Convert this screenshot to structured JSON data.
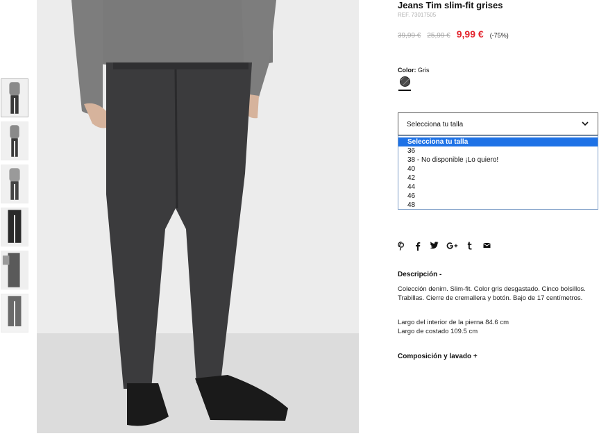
{
  "product": {
    "title": "Jeans Tim slim-fit grises",
    "ref": "REF. 73017505",
    "price_original": "39,99 €",
    "price_previous": "25,99 €",
    "price_current": "9,99 €",
    "discount": "(-75%)",
    "color_label": "Color:",
    "color_value": "Gris"
  },
  "size_select": {
    "label": "Selecciona tu talla",
    "options": [
      "Selecciona tu talla",
      "36",
      "38 - No disponible ¡Lo quiero!",
      "40",
      "42",
      "44",
      "46",
      "48"
    ],
    "selected_index": 0
  },
  "share": [
    "pinterest-icon",
    "facebook-icon",
    "twitter-icon",
    "google-plus-icon",
    "tumblr-icon",
    "mail-icon"
  ],
  "description": {
    "heading": "Descripción  -",
    "text": "Colección denim. Slim-fit. Color gris desgastado. Cinco bolsillos. Trabillas. Cierre de cremallera y botón. Bajo de 17 centímetros.",
    "line1": "Largo del interior de la pierna 84.6 cm",
    "line2": "Largo de costado 109.5 cm"
  },
  "composition": {
    "heading": "Composición y lavado  +"
  },
  "colors": {
    "price_red": "#e3262f",
    "option_highlight": "#1e72e6"
  }
}
